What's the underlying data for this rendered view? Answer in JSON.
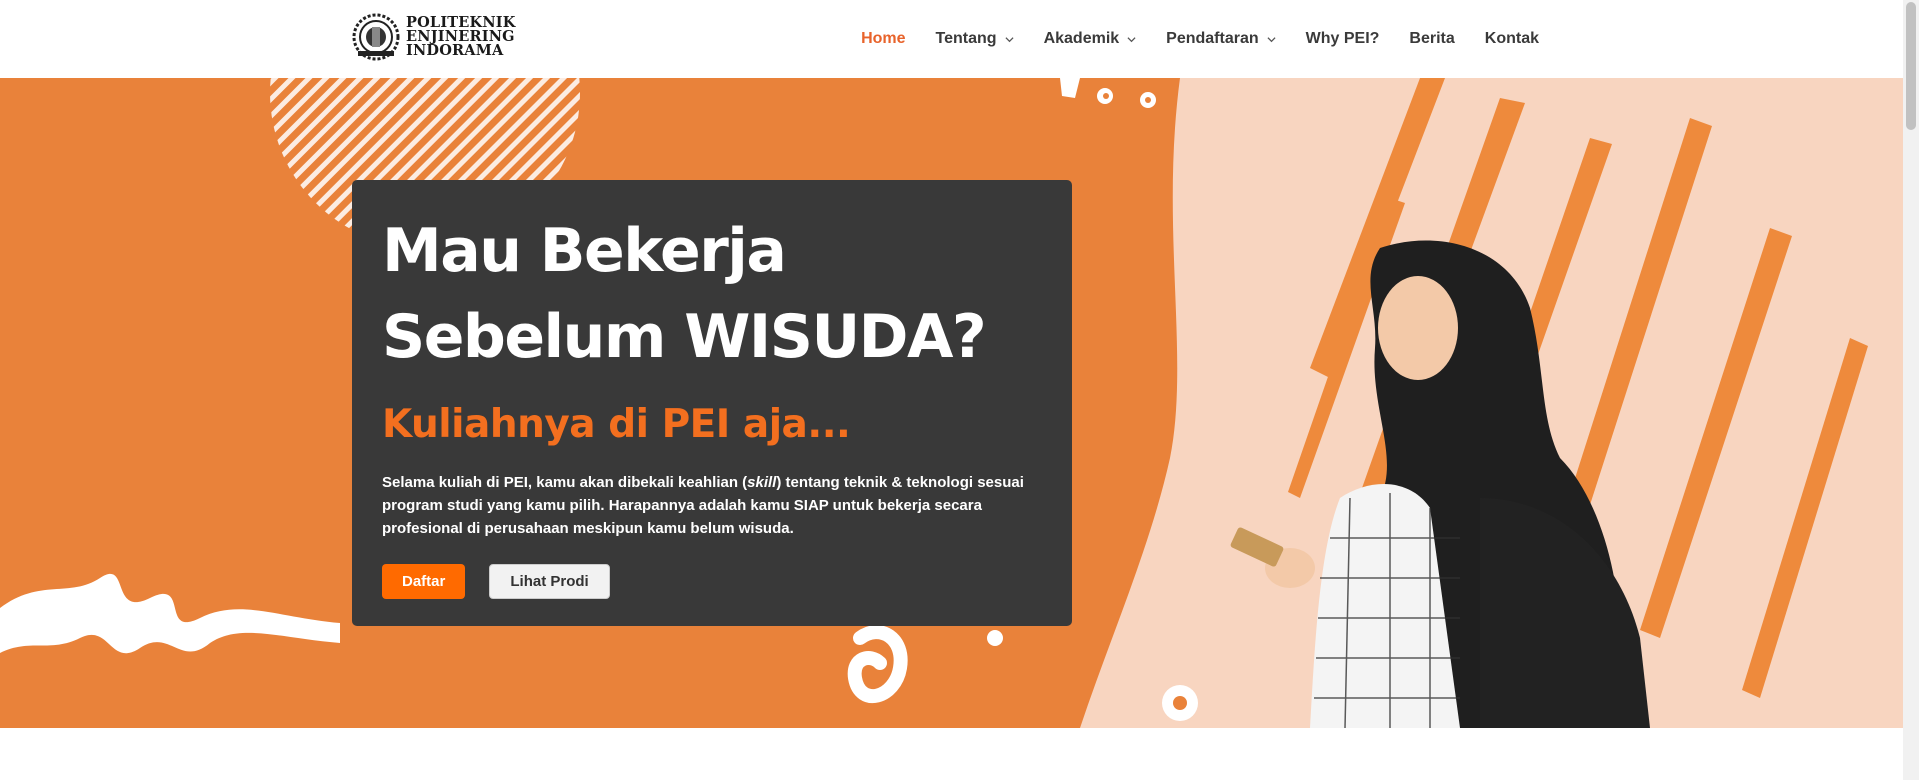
{
  "header": {
    "logo_lines": [
      "POLITEKNIK",
      "ENJINERING",
      "INDORAMA"
    ],
    "nav": [
      {
        "label": "Home",
        "active": true,
        "dropdown": false
      },
      {
        "label": "Tentang",
        "active": false,
        "dropdown": true
      },
      {
        "label": "Akademik",
        "active": false,
        "dropdown": true
      },
      {
        "label": "Pendaftaran",
        "active": false,
        "dropdown": true
      },
      {
        "label": "Why PEI?",
        "active": false,
        "dropdown": false
      },
      {
        "label": "Berita",
        "active": false,
        "dropdown": false
      },
      {
        "label": "Kontak",
        "active": false,
        "dropdown": false
      }
    ]
  },
  "hero": {
    "headline_line1": "Mau Bekerja",
    "headline_line2": "Sebelum WISUDA?",
    "subheadline": "Kuliahnya di PEI aja...",
    "description_before": "Selama kuliah di PEI, kamu akan dibekali keahlian (",
    "description_em": "skill",
    "description_after": ") tentang teknik & teknologi sesuai program studi yang kamu pilih. Harapannya adalah kamu SIAP untuk bekerja secara profesional di perusahaan meskipun kamu belum wisuda.",
    "primary_button": "Daftar",
    "secondary_button": "Lihat Prodi"
  },
  "colors": {
    "accent": "#e8632b",
    "hero_bg": "#e9823a",
    "card_bg": "#393939",
    "subhead": "#f36f1f",
    "button_primary": "#ff6a00"
  },
  "icons": [
    "politeknik-logo-icon",
    "chevron-down-icon"
  ]
}
